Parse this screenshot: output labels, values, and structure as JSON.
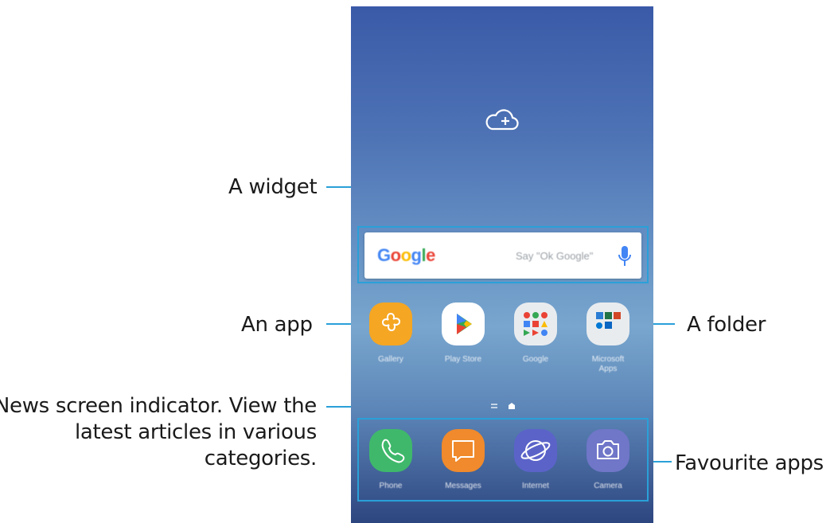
{
  "callouts": {
    "widget": "A widget",
    "app": "An app",
    "folder": "A folder",
    "news_line1": "News screen indicator. View the",
    "news_line2": "latest articles in various",
    "news_line3": "categories.",
    "favourites": "Favourite apps"
  },
  "widget": {
    "logo": [
      "G",
      "o",
      "o",
      "g",
      "l",
      "e"
    ],
    "logo_colors": [
      "#4285f4",
      "#ea4335",
      "#fbbc05",
      "#4285f4",
      "#34a853",
      "#ea4335"
    ],
    "hint": "Say \"Ok Google\"",
    "mic_color": "#4285f4"
  },
  "apps": [
    {
      "label": "Gallery",
      "icon": "gallery-flower-icon"
    },
    {
      "label": "Play Store",
      "icon": "play-store-icon"
    },
    {
      "label": "Google",
      "icon": "google-folder-icon"
    },
    {
      "label": "Microsoft\nApps",
      "icon": "microsoft-folder-icon"
    }
  ],
  "dock": [
    {
      "label": "Phone",
      "icon": "phone-icon"
    },
    {
      "label": "Messages",
      "icon": "messages-icon"
    },
    {
      "label": "Internet",
      "icon": "internet-icon"
    },
    {
      "label": "Camera",
      "icon": "camera-icon"
    }
  ],
  "colors": {
    "accent": "#2aa0d8"
  }
}
